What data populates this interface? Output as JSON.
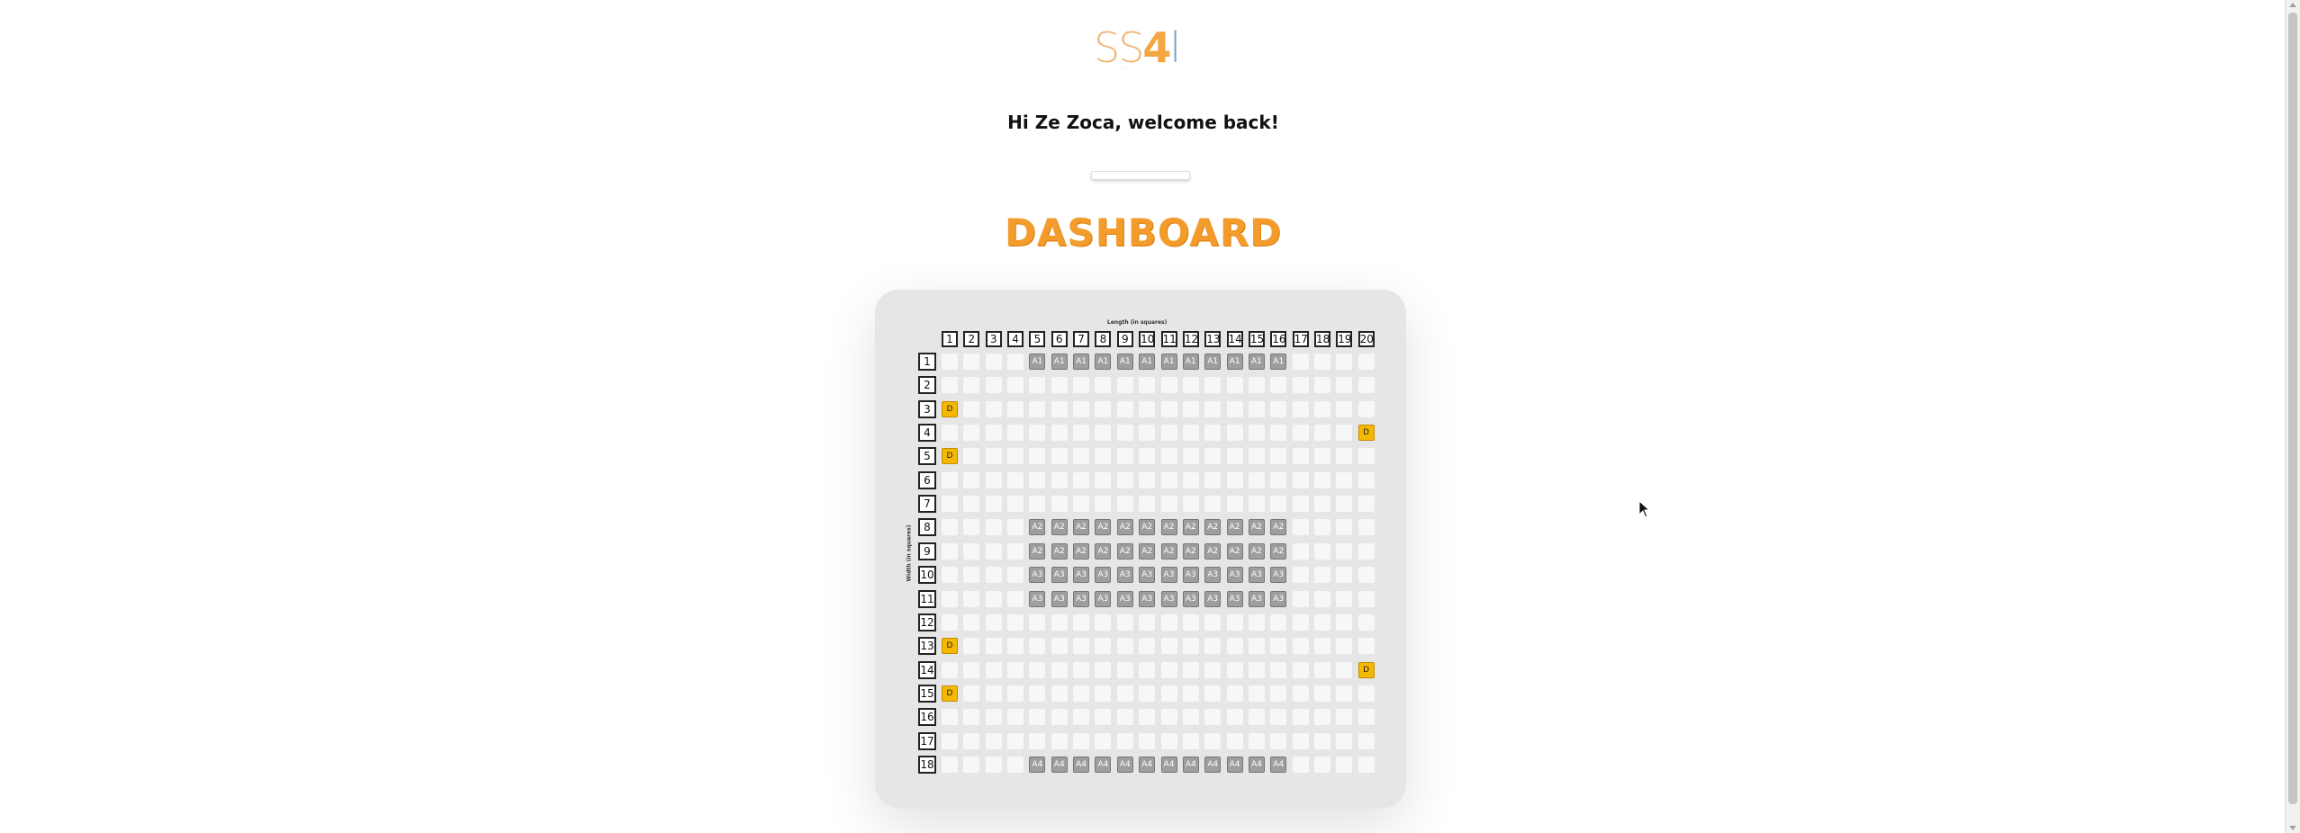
{
  "header": {
    "logo_text": "SS4",
    "logo_tagline": "......",
    "welcome": "Hi Ze Zoca, welcome back!",
    "page_title": "DASHBOARD"
  },
  "grid": {
    "length_label": "Length (in squares)",
    "width_label": "Width (in squares)",
    "columns": [
      "1",
      "2",
      "3",
      "4",
      "5",
      "6",
      "7",
      "8",
      "9",
      "10",
      "11",
      "12",
      "13",
      "14",
      "15",
      "16",
      "17",
      "18",
      "19",
      "20"
    ],
    "rows": [
      "1",
      "2",
      "3",
      "4",
      "5",
      "6",
      "7",
      "8",
      "9",
      "10",
      "11",
      "12",
      "13",
      "14",
      "15",
      "16",
      "17",
      "18"
    ],
    "allocations": [
      {
        "label": "A1",
        "rows": [
          1
        ],
        "col_from": 5,
        "col_to": 16
      },
      {
        "label": "A2",
        "rows": [
          8,
          9
        ],
        "col_from": 5,
        "col_to": 16
      },
      {
        "label": "A3",
        "rows": [
          10,
          11
        ],
        "col_from": 5,
        "col_to": 16
      },
      {
        "label": "A4",
        "rows": [
          18
        ],
        "col_from": 5,
        "col_to": 16
      }
    ],
    "doors": [
      {
        "label": "D",
        "row": 3,
        "col": 1
      },
      {
        "label": "D",
        "row": 4,
        "col": 20
      },
      {
        "label": "D",
        "row": 5,
        "col": 1
      },
      {
        "label": "D",
        "row": 13,
        "col": 1
      },
      {
        "label": "D",
        "row": 14,
        "col": 20
      },
      {
        "label": "D",
        "row": 15,
        "col": 1
      }
    ]
  },
  "colors": {
    "accent": "#f39c2b",
    "allocation": "#9e9e9e",
    "door": "#f5b800",
    "card": "#e6e6e6"
  },
  "icons": {
    "cursor": "mouse-pointer-icon"
  }
}
